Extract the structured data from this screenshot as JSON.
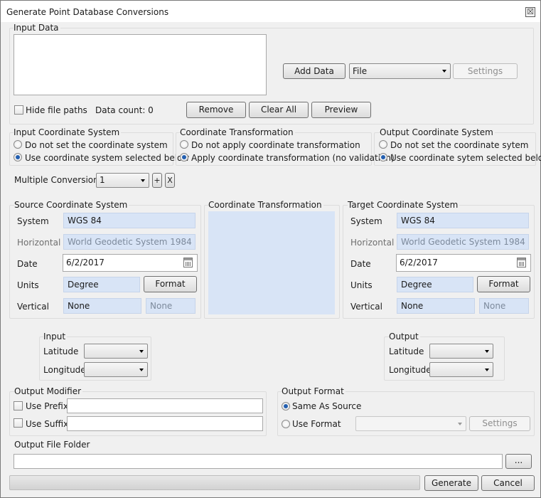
{
  "window": {
    "title": "Generate Point Database Conversions",
    "close": "☒"
  },
  "input_data": {
    "group_label": "Input Data",
    "add_data_label": "Add Data",
    "source_type": "File",
    "settings_label": "Settings",
    "hide_paths_label": "Hide file paths",
    "data_count": "Data count: 0",
    "remove_label": "Remove",
    "clear_all_label": "Clear All",
    "preview_label": "Preview"
  },
  "input_cs": {
    "group_label": "Input Coordinate System",
    "option1": "Do not set the coordinate system",
    "option2": "Use coordinate system selected below"
  },
  "transform_option": {
    "group_label": "Coordinate Transformation",
    "option1": "Do not apply coordinate transformation",
    "option2": "Apply coordinate transformation (no validation)"
  },
  "output_cs": {
    "group_label": "Output Coordinate System",
    "option1": "Do not set the coordinate sytem",
    "option2": "Use coordinate sytem selected below"
  },
  "multiple": {
    "label": "Multiple Conversion",
    "value": "1",
    "add": "+",
    "remove": "X"
  },
  "source": {
    "group_label": "Source Coordinate System",
    "system_label": "System",
    "system": "WGS 84",
    "horizontal_label": "Horizontal",
    "horizontal": "World Geodetic System 1984",
    "date_label": "Date",
    "date": "6/2/2017",
    "units_label": "Units",
    "units": "Degree",
    "format_label": "Format",
    "vertical_label": "Vertical",
    "vertical": "None",
    "vertical2": "None"
  },
  "transformation": {
    "group_label": "Coordinate Transformation"
  },
  "target": {
    "group_label": "Target Coordinate System",
    "system_label": "System",
    "system": "WGS 84",
    "horizontal_label": "Horizontal",
    "horizontal": "World Geodetic System 1984",
    "date_label": "Date",
    "date": "6/2/2017",
    "units_label": "Units",
    "units": "Degree",
    "format_label": "Format",
    "vertical_label": "Vertical",
    "vertical": "None",
    "vertical2": "None"
  },
  "input_fields": {
    "group_label": "Input",
    "latitude_label": "Latitude",
    "longitude_label": "Longitude"
  },
  "output_fields": {
    "group_label": "Output",
    "latitude_label": "Latitude",
    "longitude_label": "Longitude"
  },
  "output_modifier": {
    "group_label": "Output Modifier",
    "prefix_label": "Use Prefix",
    "suffix_label": "Use Suffix"
  },
  "output_format": {
    "group_label": "Output Format",
    "option1": "Same As Source",
    "option2": "Use Format",
    "settings_label": "Settings"
  },
  "output_folder": {
    "group_label": "Output File Folder",
    "browse_label": "..."
  },
  "footer": {
    "generate_label": "Generate",
    "cancel_label": "Cancel"
  },
  "colors": {
    "field_bg": "#d8e4f6",
    "radio_selected": "#235fb0",
    "window_bg": "#f0f0f0"
  }
}
